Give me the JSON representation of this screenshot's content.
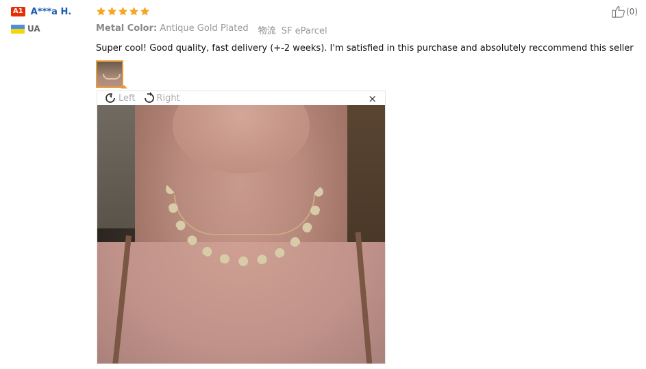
{
  "user": {
    "level_badge": "A1",
    "name": "A***a H.",
    "country": "UA"
  },
  "review": {
    "rating": 5,
    "attributes": [
      {
        "key": "Metal Color:",
        "value": "Antique Gold Plated"
      },
      {
        "key": "物流",
        "value": "SF eParcel"
      }
    ],
    "text": "Super cool! Good quality, fast delivery (+-2 weeks). I'm satisfied in this purchase and absolutely reccommend this seller"
  },
  "viewer": {
    "rotate_left_label": "Left",
    "rotate_right_label": "Right",
    "close_label": "×"
  },
  "helpful": {
    "count_text": "(0)"
  },
  "colors": {
    "star": "#f5a623",
    "badge": "#e62e04",
    "username": "#1b5ab4",
    "thumb_border": "#e59b3a"
  }
}
